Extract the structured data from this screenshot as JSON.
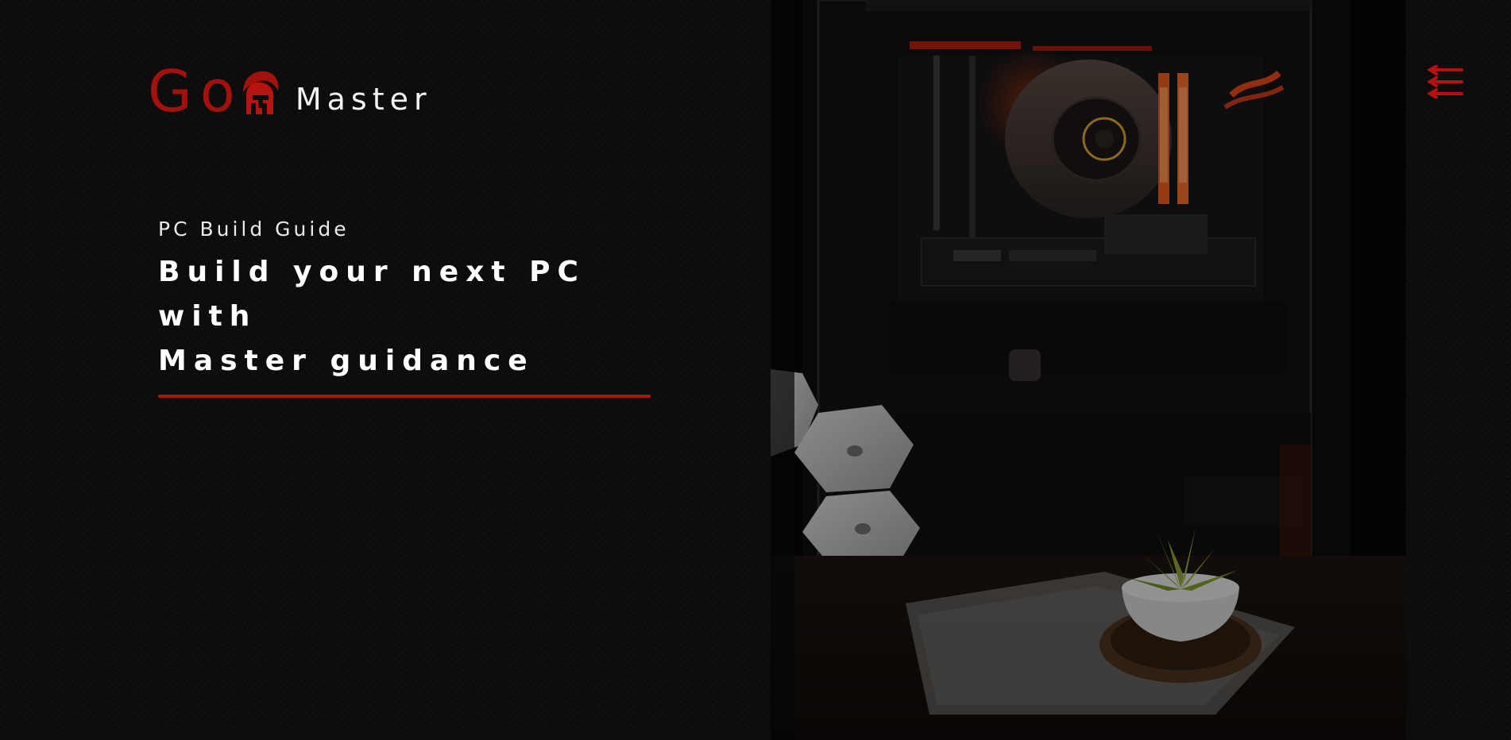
{
  "brand": {
    "go": "Go",
    "master": "Master"
  },
  "hero": {
    "kicker": "PC Build Guide",
    "title_line1": "Build your next PC with",
    "title_line2": "Master guidance"
  },
  "icons": {
    "logo": "spartan-helmet-icon",
    "menu": "hamburger-arrow-menu-icon"
  },
  "image": {
    "subject": "pc-build-photo"
  },
  "colors": {
    "accent": "#a3110d",
    "background": "#0c0c0d",
    "text": "#ffffff"
  }
}
